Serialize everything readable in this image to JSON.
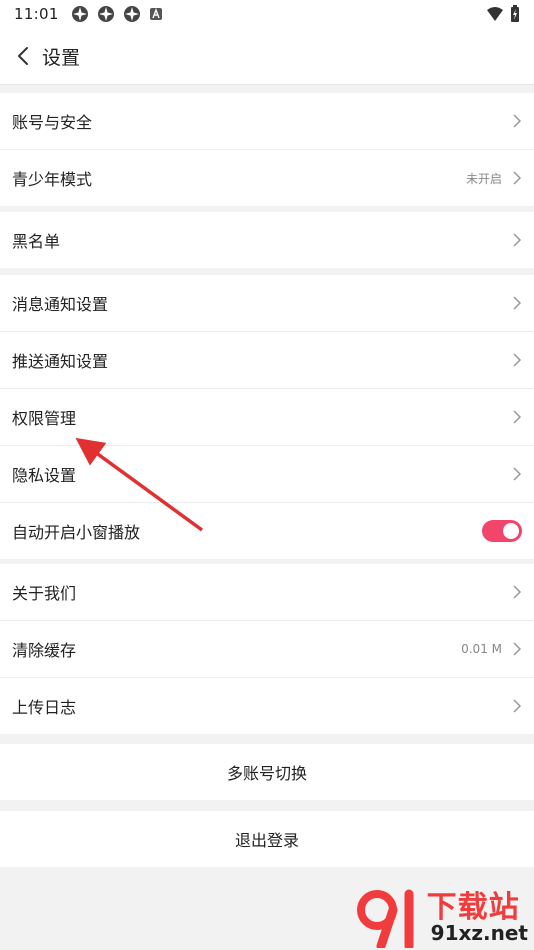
{
  "status_bar": {
    "time": "11:01",
    "notification_icons": [
      "app-icon",
      "app-icon",
      "app-icon",
      "a-icon"
    ],
    "right_icons": [
      "wifi-icon",
      "battery-icon"
    ]
  },
  "header": {
    "back_icon": "chevron-left-icon",
    "title": "设置"
  },
  "sections": [
    {
      "items": [
        {
          "label": "账号与安全",
          "value": ""
        },
        {
          "label": "青少年模式",
          "value": "未开启"
        }
      ]
    },
    {
      "items": [
        {
          "label": "黑名单",
          "value": ""
        }
      ]
    },
    {
      "items": [
        {
          "label": "消息通知设置",
          "value": ""
        },
        {
          "label": "推送通知设置",
          "value": ""
        },
        {
          "label": "权限管理",
          "value": ""
        },
        {
          "label": "隐私设置",
          "value": ""
        },
        {
          "label": "自动开启小窗播放",
          "toggle_on": true
        }
      ]
    },
    {
      "items": [
        {
          "label": "关于我们",
          "value": ""
        },
        {
          "label": "清除缓存",
          "value": "0.01 M"
        },
        {
          "label": "上传日志",
          "value": ""
        }
      ]
    }
  ],
  "actions": {
    "switch_account": "多账号切换",
    "logout": "退出登录"
  },
  "colors": {
    "accent": "#f2456a",
    "annotation_arrow": "#e03030",
    "background": "#f2f2f2"
  },
  "watermark": {
    "logo_text": "下载站",
    "site": "91xz.net"
  }
}
